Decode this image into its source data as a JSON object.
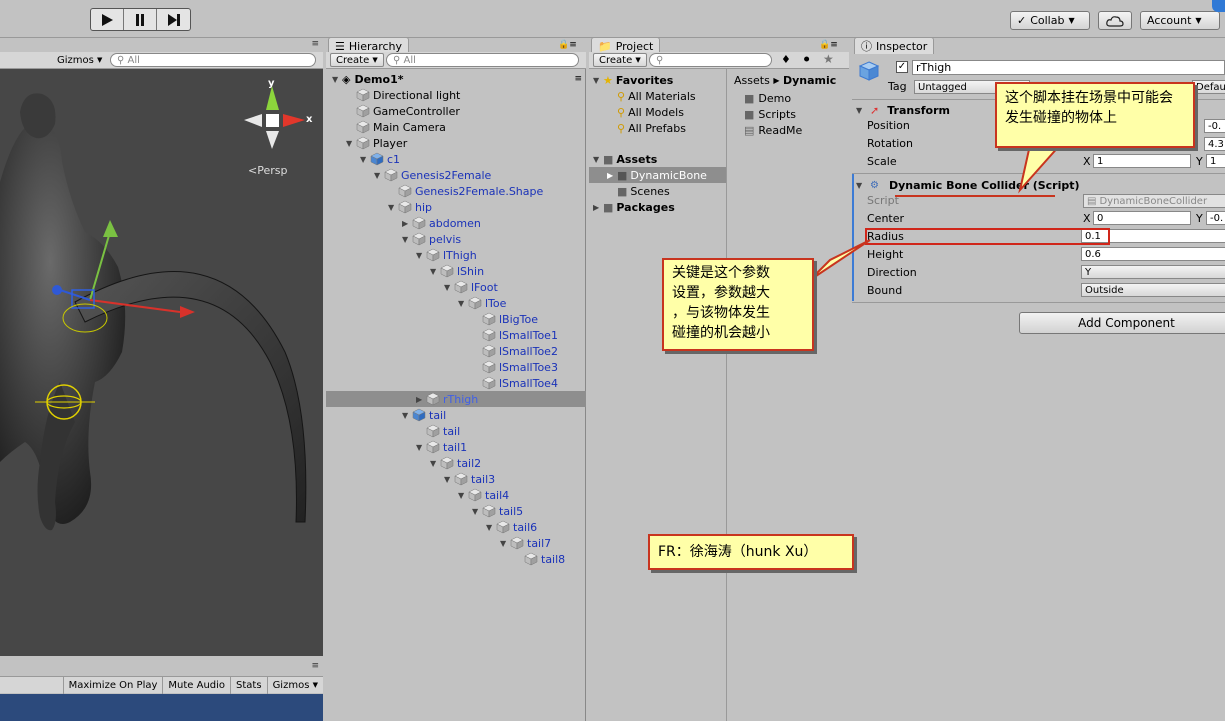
{
  "toolbar": {
    "play_icon": "play-icon",
    "pause_icon": "pause-icon",
    "step_icon": "step-icon",
    "collab_label": "Collab",
    "cloud_icon": "cloud-icon",
    "account_label": "Account"
  },
  "scene": {
    "gizmos_label": "Gizmos",
    "search_placeholder": "All",
    "persp_label": "Persp",
    "axis_y": "y",
    "axis_x": "x"
  },
  "game": {
    "maximize_label": "Maximize On Play",
    "mute_label": "Mute Audio",
    "stats_label": "Stats",
    "gizmos_label": "Gizmos"
  },
  "hierarchy": {
    "tab_label": "Hierarchy",
    "create_label": "Create",
    "search_placeholder": "All",
    "scene_name": "Demo1*",
    "items": [
      {
        "label": "Directional light",
        "depth": 1,
        "arrow": "",
        "color": "black"
      },
      {
        "label": "GameController",
        "depth": 1,
        "arrow": "",
        "color": "black"
      },
      {
        "label": "Main Camera",
        "depth": 1,
        "arrow": "",
        "color": "black"
      },
      {
        "label": "Player",
        "depth": 1,
        "arrow": "▼",
        "color": "black"
      },
      {
        "label": "c1",
        "depth": 2,
        "arrow": "▼",
        "color": "blue"
      },
      {
        "label": "Genesis2Female",
        "depth": 3,
        "arrow": "▼",
        "color": "blue"
      },
      {
        "label": "Genesis2Female.Shape",
        "depth": 4,
        "arrow": "",
        "color": "blue"
      },
      {
        "label": "hip",
        "depth": 4,
        "arrow": "▼",
        "color": "blue"
      },
      {
        "label": "abdomen",
        "depth": 5,
        "arrow": "▶",
        "color": "blue"
      },
      {
        "label": "pelvis",
        "depth": 5,
        "arrow": "▼",
        "color": "blue"
      },
      {
        "label": "lThigh",
        "depth": 6,
        "arrow": "▼",
        "color": "blue"
      },
      {
        "label": "lShin",
        "depth": 7,
        "arrow": "▼",
        "color": "blue"
      },
      {
        "label": "lFoot",
        "depth": 8,
        "arrow": "▼",
        "color": "blue"
      },
      {
        "label": "lToe",
        "depth": 9,
        "arrow": "▼",
        "color": "blue"
      },
      {
        "label": "lBigToe",
        "depth": 10,
        "arrow": "",
        "color": "blue"
      },
      {
        "label": "lSmallToe1",
        "depth": 10,
        "arrow": "",
        "color": "blue"
      },
      {
        "label": "lSmallToe2",
        "depth": 10,
        "arrow": "",
        "color": "blue"
      },
      {
        "label": "lSmallToe3",
        "depth": 10,
        "arrow": "",
        "color": "blue"
      },
      {
        "label": "lSmallToe4",
        "depth": 10,
        "arrow": "",
        "color": "blue"
      },
      {
        "label": "rThigh",
        "depth": 6,
        "arrow": "▶",
        "color": "selected"
      },
      {
        "label": "tail",
        "depth": 5,
        "arrow": "▼",
        "color": "blue"
      },
      {
        "label": "tail",
        "depth": 6,
        "arrow": "",
        "color": "blue"
      },
      {
        "label": "tail1",
        "depth": 6,
        "arrow": "▼",
        "color": "blue"
      },
      {
        "label": "tail2",
        "depth": 7,
        "arrow": "▼",
        "color": "blue"
      },
      {
        "label": "tail3",
        "depth": 8,
        "arrow": "▼",
        "color": "blue"
      },
      {
        "label": "tail4",
        "depth": 9,
        "arrow": "▼",
        "color": "blue"
      },
      {
        "label": "tail5",
        "depth": 10,
        "arrow": "▼",
        "color": "blue"
      },
      {
        "label": "tail6",
        "depth": 11,
        "arrow": "▼",
        "color": "blue"
      },
      {
        "label": "tail7",
        "depth": 12,
        "arrow": "▼",
        "color": "blue"
      },
      {
        "label": "tail8",
        "depth": 13,
        "arrow": "",
        "color": "blue"
      }
    ]
  },
  "project": {
    "tab_label": "Project",
    "create_label": "Create",
    "favorites_label": "Favorites",
    "favorites": [
      "All Materials",
      "All Models",
      "All Prefabs"
    ],
    "assets_label": "Assets",
    "assets_children": [
      "DynamicBone",
      "Scenes"
    ],
    "packages_label": "Packages",
    "breadcrumb_root": "Assets",
    "breadcrumb_current": "Dynamic",
    "files": [
      "Demo",
      "Scripts",
      "ReadMe"
    ]
  },
  "inspector": {
    "tab_label": "Inspector",
    "object_name": "rThigh",
    "tag_label": "Tag",
    "tag_value": "Untagged",
    "layer_value": "Defau",
    "transform_title": "Transform",
    "position_label": "Position",
    "rotation_label": "Rotation",
    "scale_label": "Scale",
    "position_x": "-0.",
    "rotation_x": "4.3",
    "scale_x_label": "X",
    "scale_x": "1",
    "scale_y_label": "Y",
    "scale_y": "1",
    "component_title": "Dynamic Bone Collider (Script)",
    "script_label": "Script",
    "script_value": "DynamicBoneCollider",
    "center_label": "Center",
    "center_x_label": "X",
    "center_x": "0",
    "center_y_label": "Y",
    "center_y": "-0.",
    "radius_label": "Radius",
    "radius_value": "0.1",
    "height_label": "Height",
    "height_value": "0.6",
    "direction_label": "Direction",
    "direction_value": "Y",
    "bound_label": "Bound",
    "bound_value": "Outside",
    "add_component_label": "Add Component"
  },
  "annotations": {
    "note1": "这个脚本挂在场景中可能会发生碰撞的物体上",
    "note2_lines": [
      "关键是这个参数",
      "设置，参数越大",
      "，与该物体发生",
      "碰撞的机会越小"
    ],
    "credit": "FR：徐海涛（hunk Xu）"
  },
  "colors": {
    "selection_text": "#4060e8",
    "annotation_border": "#c8341e",
    "annotation_fill": "#ffffa8",
    "scene_bg": "#474747"
  }
}
